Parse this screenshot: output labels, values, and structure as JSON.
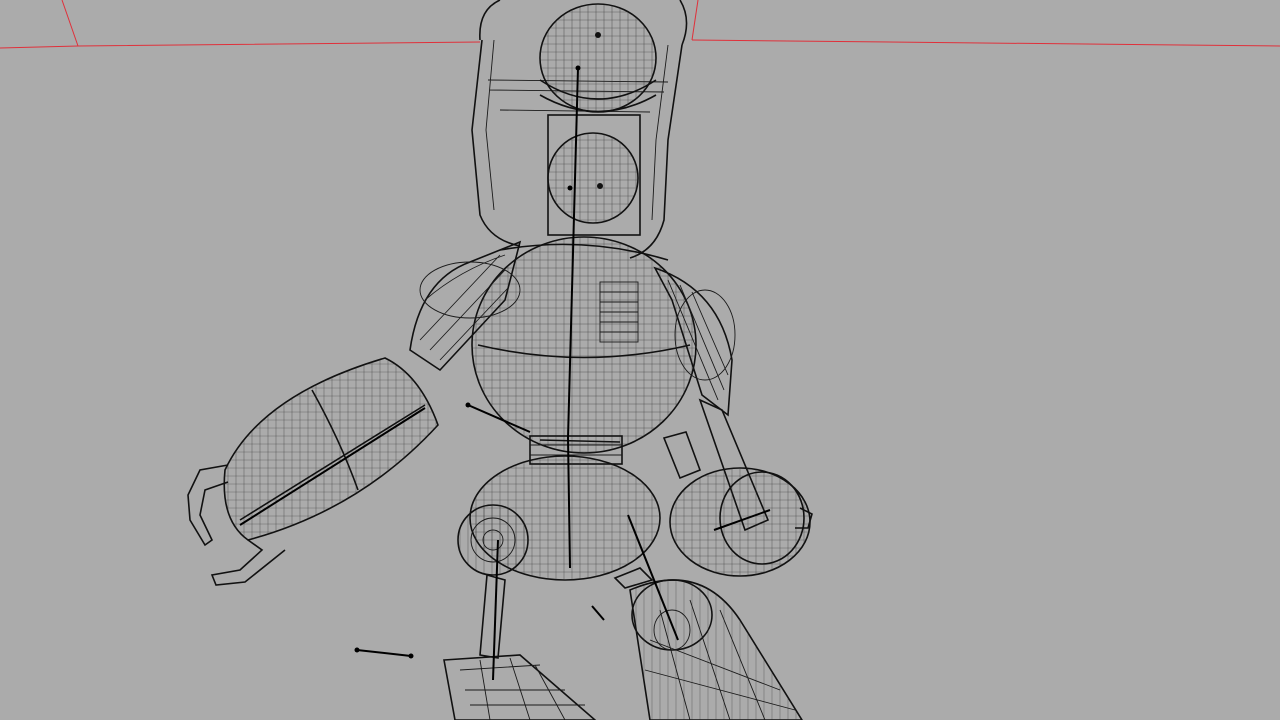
{
  "viewport": {
    "label": "",
    "background": "#ababab",
    "wire_color": "#1a1a1a",
    "selection_color": "#e0303a",
    "display_mode": "wireframe",
    "subject": "robot-character-mesh"
  }
}
